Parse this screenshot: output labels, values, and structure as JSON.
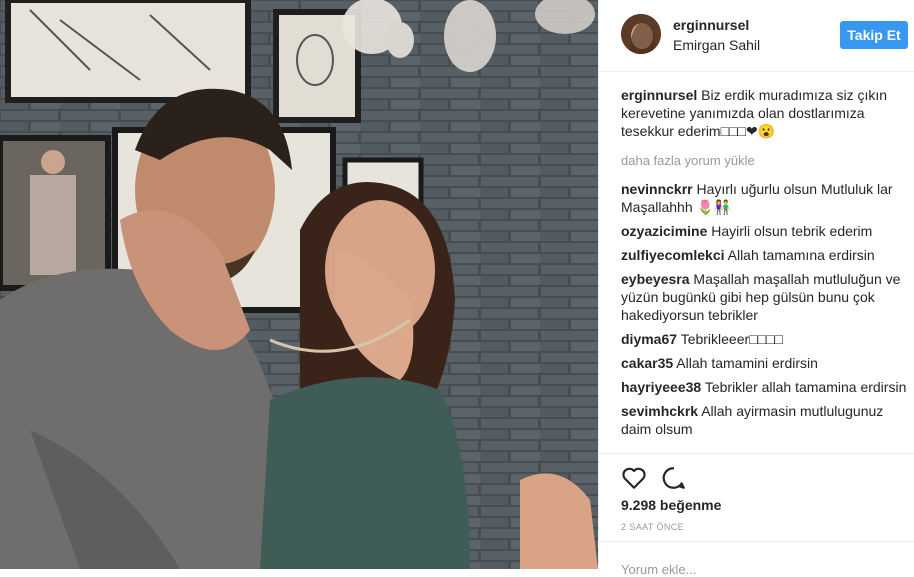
{
  "post": {
    "username": "erginnursel",
    "location": "Emirgan Sahil",
    "follow_label": "Takip Et",
    "caption_text": "Biz erdik muradımıza siz çıkın kerevetine yanımızda olan dostlarımıza tesekkur ederim□□□❤😮",
    "load_more": "daha fazla yorum yükle",
    "likes": "9.298 beğenme",
    "time": "2 SAAT ÖNCE",
    "add_comment_placeholder": "Yorum ekle..."
  },
  "comments": [
    {
      "user": "nevinnckrr",
      "text": "Hayırlı uğurlu olsun Mutluluk lar Maşallahhh 🌷👫"
    },
    {
      "user": "ozyazicimine",
      "text": "Hayirli olsun tebrik ederim"
    },
    {
      "user": "zulfiyecomlekci",
      "text": "Allah tamamına erdirsin"
    },
    {
      "user": "eybeyesra",
      "text": "Maşallah maşallah mutluluğun ve yüzün bugünkü gibi hep gülsün bunu çok hakediyorsun tebrikler"
    },
    {
      "user": "diyma67",
      "text": "Tebrikleeer□□□□"
    },
    {
      "user": "cakar35",
      "text": "Allah tamamini erdirsin"
    },
    {
      "user": "hayriyeee38",
      "text": "Tebrikler allah tamamina erdirsin"
    },
    {
      "user": "sevimhckrk",
      "text": "Allah ayirmasin mutlulugunuz daim olsum"
    }
  ],
  "icons": {
    "like": "heart-icon",
    "comment": "comment-icon"
  },
  "colors": {
    "accent": "#3897f0",
    "muted": "#999999",
    "text": "#262626"
  }
}
